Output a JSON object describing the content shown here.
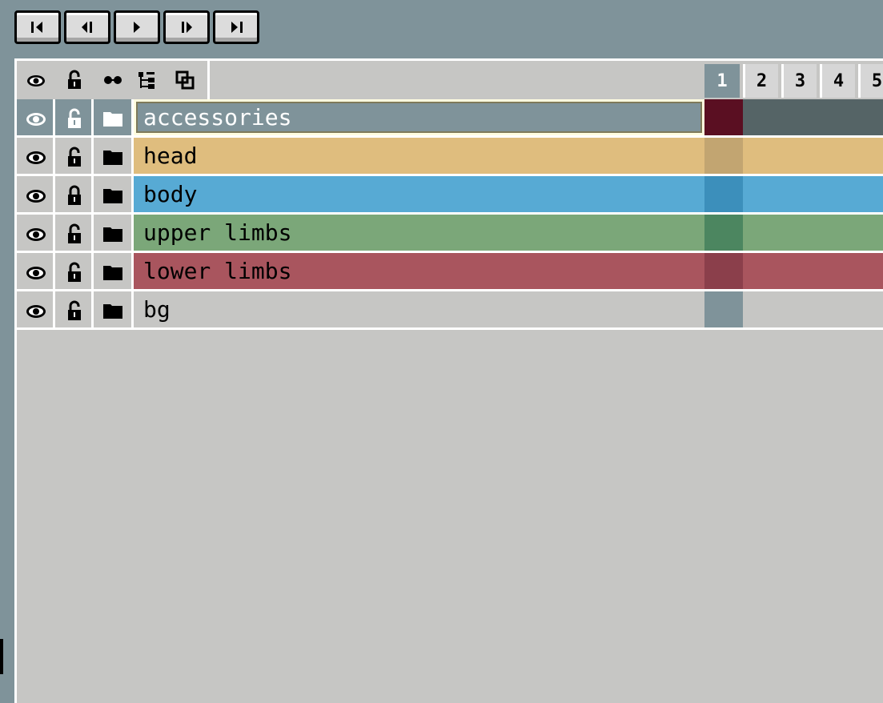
{
  "toolbar": {
    "buttons": [
      {
        "icon": "first-frame-icon"
      },
      {
        "icon": "previous-frame-icon"
      },
      {
        "icon": "play-icon"
      },
      {
        "icon": "next-frame-icon"
      },
      {
        "icon": "last-frame-icon"
      }
    ]
  },
  "header": {
    "icons": [
      "visibility-eye-icon",
      "lock-icon",
      "continuous-icon",
      "layer-tree-icon",
      "link-cels-icon"
    ],
    "frames": [
      "1",
      "2",
      "3",
      "4",
      "5"
    ],
    "active_frame": "1"
  },
  "layers": [
    {
      "name": "accessories",
      "color": "#7f939a",
      "cel_color": "#5a0f22",
      "selected": true,
      "locked": false
    },
    {
      "name": "head",
      "color": "#dfbd7e",
      "cel_color": "#c2a571",
      "selected": false,
      "locked": false
    },
    {
      "name": "body",
      "color": "#57aad4",
      "cel_color": "#3c8fbb",
      "selected": false,
      "locked": true
    },
    {
      "name": "upper limbs",
      "color": "#7ba779",
      "cel_color": "#4c8660",
      "selected": false,
      "locked": false
    },
    {
      "name": "lower limbs",
      "color": "#a9555e",
      "cel_color": "#8b3f4b",
      "selected": false,
      "locked": false
    },
    {
      "name": "bg",
      "color": "#c6c6c4",
      "cel_color": "#7f939a",
      "selected": false,
      "locked": false
    }
  ],
  "colors": {
    "window_bg": "#7f939a",
    "panel_bg": "#c6c6c4",
    "selection_rest": "#556466"
  }
}
